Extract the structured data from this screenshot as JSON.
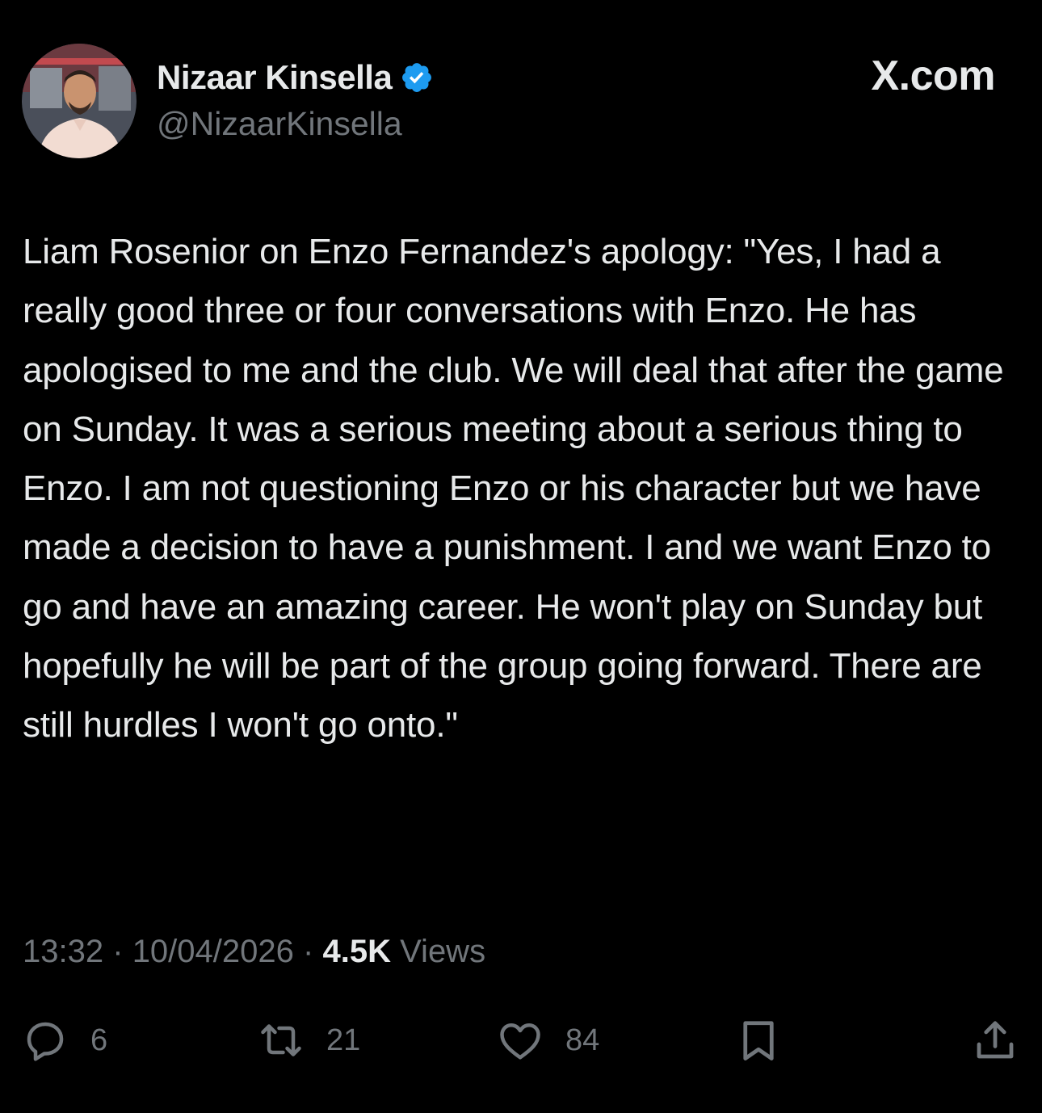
{
  "author": {
    "name": "Nizaar Kinsella",
    "handle": "@NizaarKinsella",
    "verified": true,
    "avatar_icon": "avatar-photo"
  },
  "brand": "X.com",
  "tweet": {
    "text": "Liam Rosenior on Enzo Fernandez's apology: \"Yes, I had a really good three or four conversations with Enzo. He has apologised to me and the club. We will deal that after the game on Sunday. It was a serious meeting about a serious thing to Enzo. I am not questioning Enzo or his character but we have made a decision to have a punishment. I and we want Enzo to go and have an amazing career. He won't play on Sunday but hopefully he will be part of the group going forward. There are still hurdles I won't go onto.\""
  },
  "meta": {
    "time": "13:32",
    "separator": "·",
    "date": "10/04/2026",
    "views_count": "4.5K",
    "views_label": "Views"
  },
  "actions": {
    "replies": "6",
    "reposts": "21",
    "likes": "84"
  },
  "colors": {
    "background": "#000000",
    "text": "#e7e9ea",
    "muted": "#71767b",
    "verified": "#1d9bf0"
  }
}
